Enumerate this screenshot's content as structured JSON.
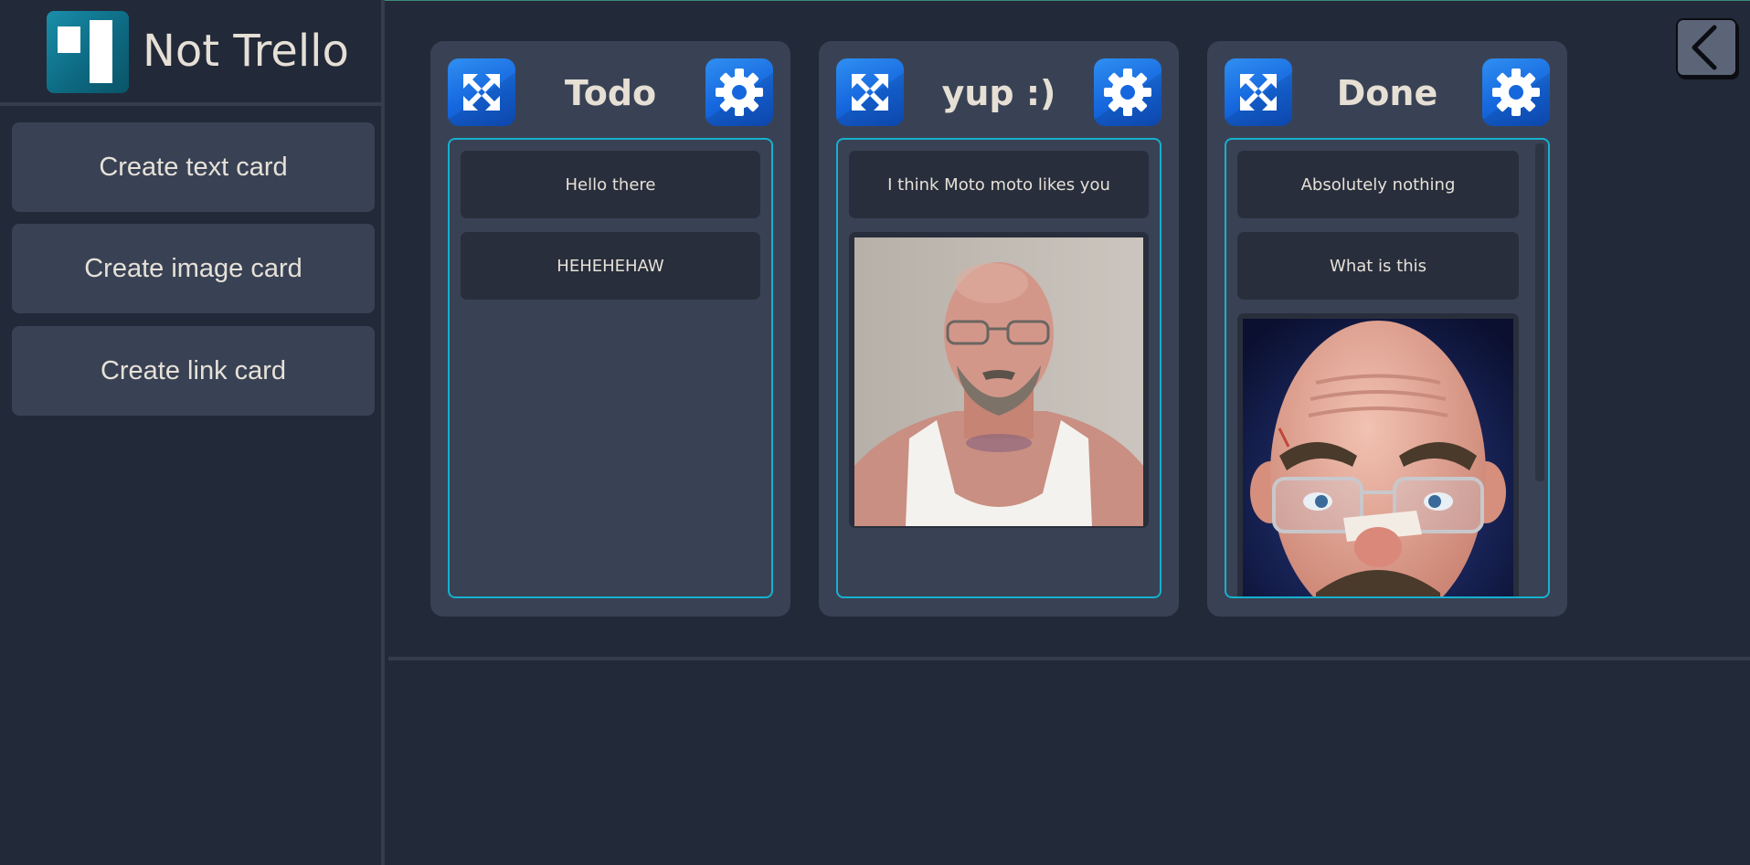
{
  "app": {
    "title": "Not Trello"
  },
  "sidebar": {
    "buttons": [
      {
        "label": "Create text card"
      },
      {
        "label": "Create image card"
      },
      {
        "label": "Create link card"
      }
    ]
  },
  "columns": [
    {
      "title": "Todo",
      "cards": [
        {
          "type": "text",
          "text": "Hello there"
        },
        {
          "type": "text",
          "text": "HEHEHEHAW"
        }
      ]
    },
    {
      "title": "yup :)",
      "cards": [
        {
          "type": "text",
          "text": "I think Moto moto likes you"
        },
        {
          "type": "image",
          "alt": "photo of bald bearded man in tank top"
        }
      ]
    },
    {
      "title": "Done",
      "cards": [
        {
          "type": "text",
          "text": "Absolutely nothing"
        },
        {
          "type": "text",
          "text": "What is this"
        },
        {
          "type": "image",
          "alt": "3D cartoon bald man with glasses"
        }
      ]
    }
  ],
  "icons": {
    "move": "move-arrows-icon",
    "settings": "gear-icon",
    "back": "chevron-left-icon"
  },
  "colors": {
    "background": "#222938",
    "panel": "#394254",
    "card": "#282e3b",
    "accent_border": "#16b0cf",
    "icon_blue": "#1667de",
    "text": "#e6e1d8"
  }
}
